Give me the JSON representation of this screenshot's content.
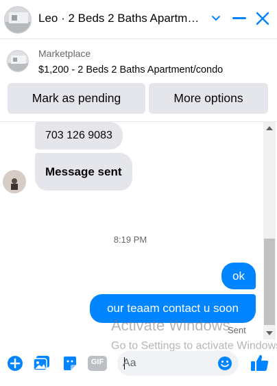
{
  "header": {
    "title": "Leo · 2 Beds 2 Baths Apartment/condo",
    "icons": [
      "chevron-down-icon",
      "minimize-icon",
      "close-icon"
    ]
  },
  "listing": {
    "label": "Marketplace",
    "description": "$1,200 - 2 Beds 2 Baths Apartment/condo",
    "buttons": {
      "mark_pending": "Mark as pending",
      "more_options": "More options"
    }
  },
  "messages": {
    "incoming": [
      {
        "text": "703 126 9083"
      },
      {
        "text": "Message sent"
      }
    ],
    "timestamp": "8:19 PM",
    "outgoing": [
      {
        "text": "ok"
      },
      {
        "text": "our teaam contact u soon"
      }
    ],
    "status": "Sent"
  },
  "watermark": {
    "line1": "Activate Windows",
    "line2": "Go to Settings to activate Windows."
  },
  "composer": {
    "placeholder": "Aa",
    "tools": [
      "add-icon",
      "photo-icon",
      "sticker-icon",
      "gif-icon",
      "emoji-icon",
      "thumbs-up-icon"
    ],
    "gif_label": "GIF"
  },
  "colors": {
    "accent": "#0084ff",
    "bubble_in": "#e4e6eb",
    "button_bg": "#e4e6eb"
  }
}
